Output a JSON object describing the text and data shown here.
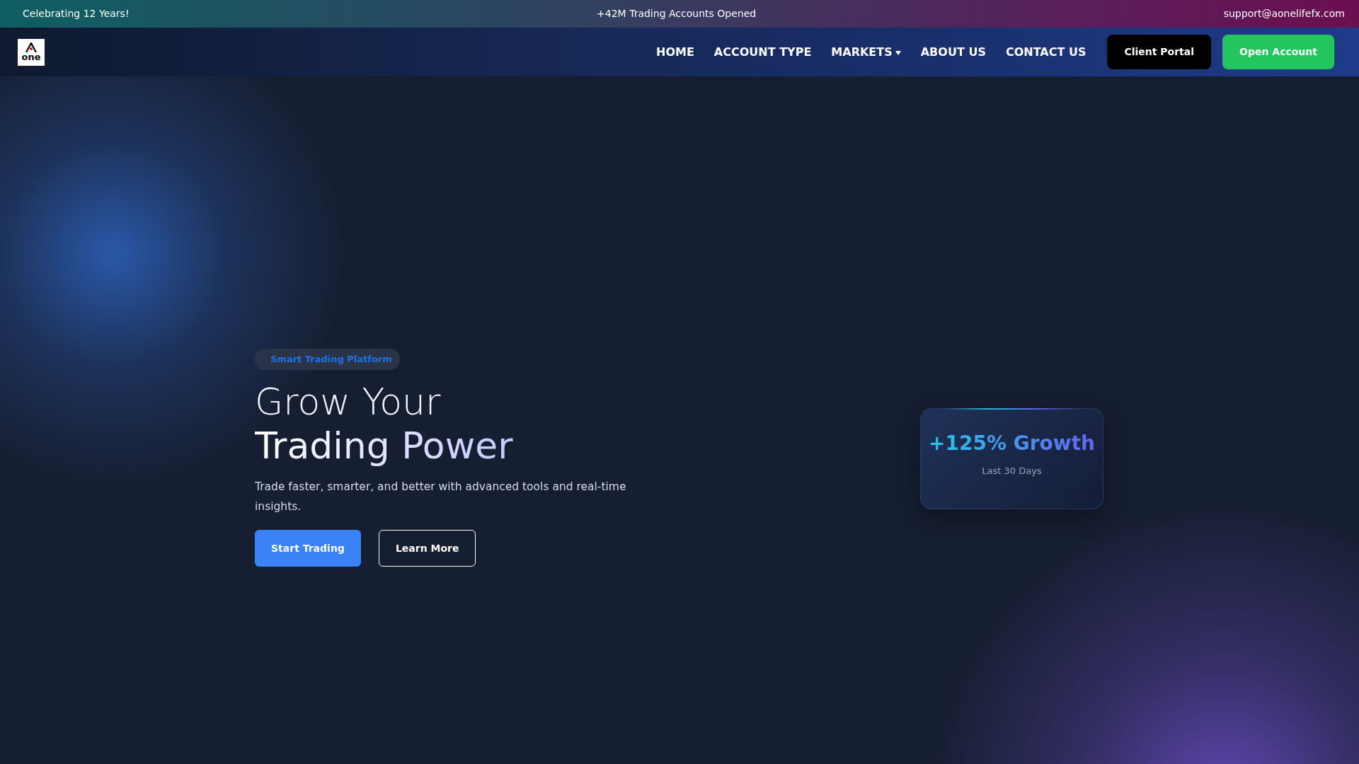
{
  "top_bar": {
    "left": "Celebrating 12 Years!",
    "center": "+42M Trading Accounts Opened",
    "right": "support@aonelifefx.com"
  },
  "logo": {
    "text": "one"
  },
  "nav": [
    {
      "label": "HOME",
      "dropdown": false
    },
    {
      "label": "ACCOUNT TYPE",
      "dropdown": false
    },
    {
      "label": "MARKETS",
      "dropdown": true
    },
    {
      "label": "ABOUT US",
      "dropdown": false
    },
    {
      "label": "CONTACT US",
      "dropdown": false
    }
  ],
  "nav_buttons": [
    {
      "label": "Client Portal",
      "kind": "dark"
    },
    {
      "label": "Open Account",
      "kind": "green"
    }
  ],
  "hero": {
    "badge": "Smart Trading Platform",
    "title_line_1": "Grow Your",
    "title_line_2": "Trading Power",
    "text": "Trade faster, smarter, and better with advanced tools and real-time insights.",
    "buttons": [
      {
        "label": "Start Trading",
        "kind": "primary"
      },
      {
        "label": "Learn More",
        "kind": "outline"
      }
    ]
  },
  "stat_card": {
    "value": "+125% Growth",
    "caption": "Last 30 Days"
  }
}
